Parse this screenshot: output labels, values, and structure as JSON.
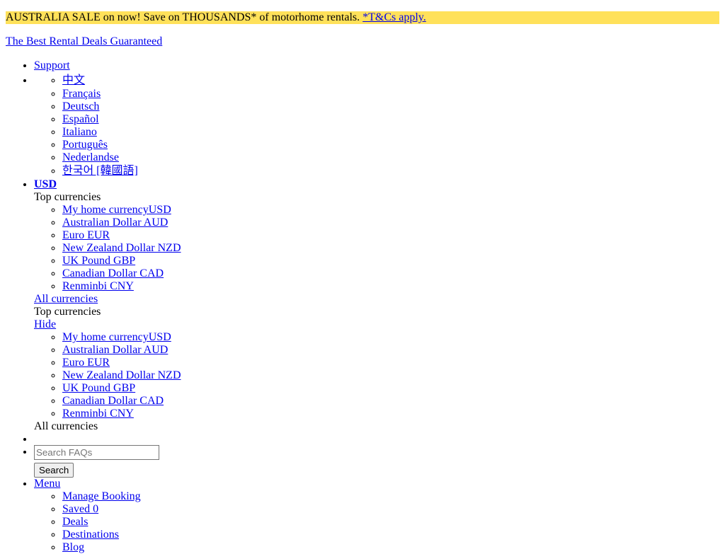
{
  "promo": {
    "text": "AUSTRALIA SALE on now! Save on THOUSANDS* of motorhome rentals.",
    "terms_link": "*T&Cs apply."
  },
  "tagline": "The Best Rental Deals Guaranteed",
  "nav": {
    "support": "Support",
    "languages": [
      "中文",
      "Français",
      "Deutsch",
      "Español",
      "Italiano",
      "Português",
      "Nederlandse",
      "한국어 [韓國語]"
    ],
    "currency": {
      "current": "USD",
      "top_heading": "Top currencies",
      "items": [
        "My home currencyUSD",
        "Australian Dollar AUD",
        "Euro EUR",
        "New Zealand Dollar NZD",
        "UK Pound GBP",
        "Canadian Dollar CAD",
        "Renminbi CNY"
      ],
      "all_link": "All currencies",
      "top_heading_2": "Top currencies",
      "hide_link": "Hide",
      "items_2": [
        "My home currencyUSD",
        "Australian Dollar AUD",
        "Euro EUR",
        "New Zealand Dollar NZD",
        "UK Pound GBP",
        "Canadian Dollar CAD",
        "Renminbi CNY"
      ],
      "all_label": "All currencies"
    },
    "search": {
      "placeholder": "Search FAQs",
      "button": "Search"
    },
    "menu": {
      "label": "Menu",
      "items": [
        "Manage Booking",
        "Saved 0",
        "Deals",
        "Destinations",
        "Blog"
      ]
    }
  }
}
